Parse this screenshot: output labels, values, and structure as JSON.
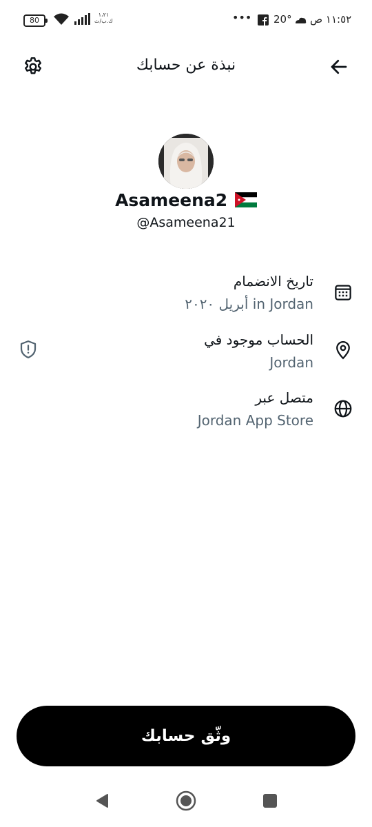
{
  "status_bar": {
    "battery": "80",
    "net_speed": "١،٢١\nك.ب/ث",
    "more": "•••",
    "temperature": "20°",
    "time": "١١:٥٢ ص"
  },
  "header": {
    "title": "نبذة عن حسابك"
  },
  "profile": {
    "display_name": "Asameena2",
    "username": "@Asameena21"
  },
  "info": {
    "joined": {
      "title": "تاريخ الانضمام",
      "value": "أبريل ٢٠٢٠ in Jordan"
    },
    "location": {
      "title": "الحساب موجود في",
      "value": "Jordan"
    },
    "connected": {
      "title": "متصل عبر",
      "value": "Jordan App Store"
    }
  },
  "actions": {
    "verify_label": "وثّق حسابك"
  },
  "colors": {
    "primary_text": "#0f1419",
    "secondary_text": "#536471",
    "button_bg": "#000000"
  },
  "icons": [
    "settings-gear-icon",
    "back-arrow-icon",
    "calendar-icon",
    "location-pin-icon",
    "globe-icon",
    "shield-alert-icon",
    "jordan-flag-icon"
  ]
}
